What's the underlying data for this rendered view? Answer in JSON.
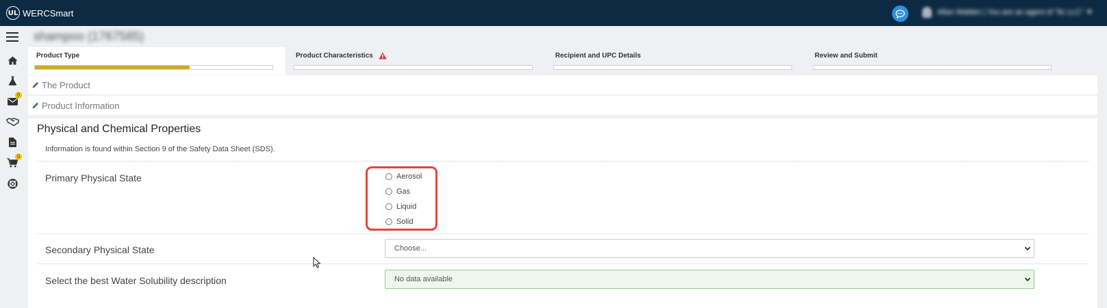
{
  "app": {
    "logo_text": "UL",
    "title": "WERCSmart"
  },
  "header": {
    "user_name": "Allan Walden | You are an agent of \"ltc LLC\" ▼"
  },
  "page": {
    "heading": "shampoo (1767585)"
  },
  "sidebar": {
    "items": [
      {
        "name": "menu-icon"
      },
      {
        "name": "home-icon"
      },
      {
        "name": "flask-icon"
      },
      {
        "name": "mail-icon",
        "badge": "0"
      },
      {
        "name": "handshake-icon"
      },
      {
        "name": "document-icon"
      },
      {
        "name": "cart-icon",
        "badge": "0"
      },
      {
        "name": "lifebuoy-icon"
      }
    ]
  },
  "stepper": {
    "steps": [
      {
        "label": "Product Type",
        "progress": 0.65
      },
      {
        "label": "Product Characteristics",
        "warning_icon": "warning-icon"
      },
      {
        "label": "Recipient and UPC Details"
      },
      {
        "label": "Review and Submit"
      }
    ],
    "accent_color": "#d4a52a",
    "warning_color": "#d9303a"
  },
  "panels": {
    "product": "The Product",
    "product_information": "Product Information"
  },
  "section": {
    "title": "Physical and Chemical Properties",
    "info": "Information is found within Section 9 of the Safety Data Sheet (SDS).",
    "primary_state": {
      "label": "Primary Physical State",
      "options": [
        "Aerosol",
        "Gas",
        "Liquid",
        "Solid"
      ],
      "highlight_color": "#e0463b"
    },
    "secondary_state": {
      "label": "Secondary Physical State",
      "selected": "Choose..."
    },
    "water_solubility": {
      "label": "Select the best Water Solubility description",
      "selected": "No data available"
    }
  }
}
